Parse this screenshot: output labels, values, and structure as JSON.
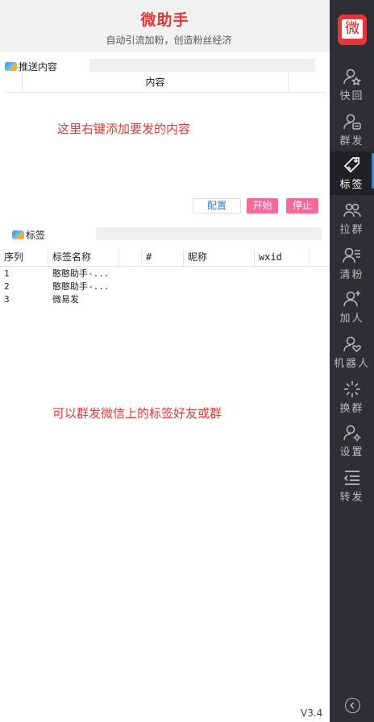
{
  "header": {
    "title": "微助手",
    "subtitle": "自动引流加粉，创造粉丝经济"
  },
  "push": {
    "section_label": "推送内容",
    "columns": [
      "内容"
    ],
    "hint": "这里右键添加要发的内容"
  },
  "buttons": {
    "config": "配置",
    "start": "开始",
    "stop": "停止"
  },
  "tags": {
    "section_label": "标签",
    "columns": [
      "序列",
      "标签名称",
      "#",
      "昵称",
      "wxid"
    ],
    "rows": [
      {
        "index": "1",
        "name": "憨憨助手-..."
      },
      {
        "index": "2",
        "name": "憨憨助手-..."
      },
      {
        "index": "3",
        "name": "微易发"
      }
    ],
    "hint": "可以群发微信上的标签好友或群"
  },
  "version": "V3.4",
  "sidebar": {
    "logo_glyph": "微",
    "items": [
      {
        "label": "快回",
        "icon": "user-star-icon"
      },
      {
        "label": "群发",
        "icon": "user-chat-icon"
      },
      {
        "label": "标签",
        "icon": "tag-icon",
        "active": true
      },
      {
        "label": "拉群",
        "icon": "group-icon"
      },
      {
        "label": "清粉",
        "icon": "user-list-icon"
      },
      {
        "label": "加人",
        "icon": "user-plus-icon"
      },
      {
        "label": "机器人",
        "icon": "user-heart-icon"
      },
      {
        "label": "换群",
        "icon": "sparkle-icon"
      },
      {
        "label": "设置",
        "icon": "user-gear-icon"
      },
      {
        "label": "转发",
        "icon": "forward-list-icon"
      }
    ]
  },
  "colors": {
    "accent_red": "#e53935",
    "button_pink": "#f06a9a",
    "sidebar_bg": "#2d2f33",
    "active_marker": "#2e86de"
  }
}
